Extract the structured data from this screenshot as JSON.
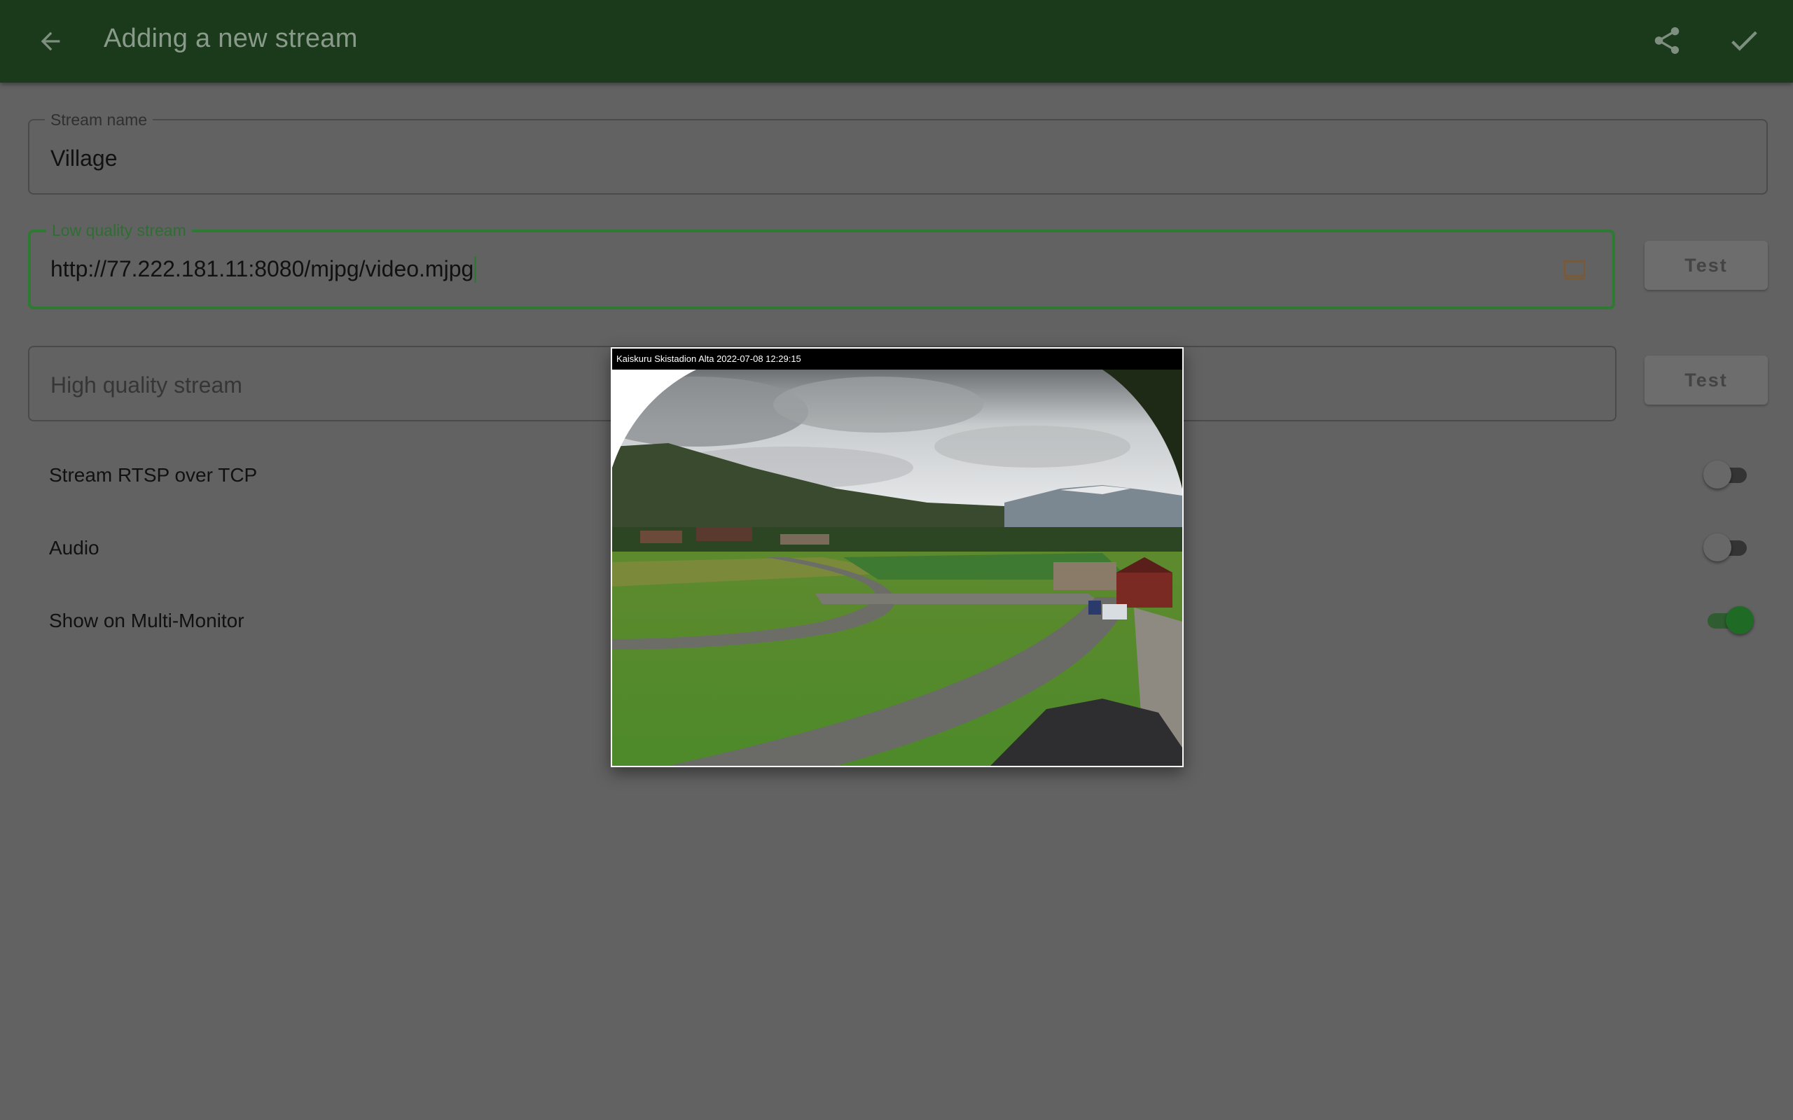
{
  "app_bar": {
    "title": "Adding a new stream",
    "back_icon": "arrow-back-icon",
    "share_icon": "share-icon",
    "confirm_icon": "check-icon",
    "background_color": "#1a3a1b"
  },
  "form": {
    "stream_name": {
      "label": "Stream name",
      "value": "Village"
    },
    "low_quality": {
      "label": "Low quality stream",
      "value": "http://77.222.181.11:8080/mjpg/video.mjpg",
      "trailing_icon": "cast-icon",
      "test_label": "Test"
    },
    "high_quality": {
      "placeholder": "High quality stream",
      "value": "",
      "test_label": "Test"
    }
  },
  "toggles": [
    {
      "label": "Stream RTSP over TCP",
      "on": false
    },
    {
      "label": "Audio",
      "on": false
    },
    {
      "label": "Show on Multi-Monitor",
      "on": true
    }
  ],
  "preview": {
    "overlay_text": "Kaiskuru Skistadion Alta 2022-07-08 12:29:15"
  },
  "colors": {
    "accent": "#2d7a32",
    "scrim_background": "#626262"
  }
}
